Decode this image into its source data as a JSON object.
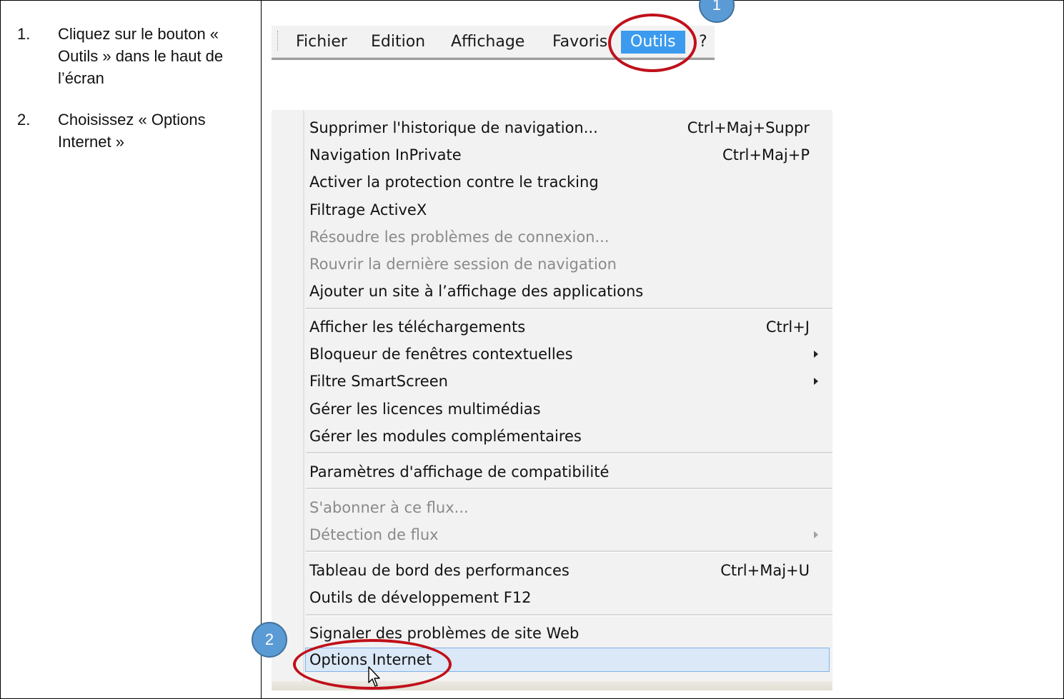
{
  "instructions": [
    {
      "number": "1.",
      "text": "Cliquez sur le bouton « Outils » dans le haut de l’écran"
    },
    {
      "number": "2.",
      "text": "Choisissez « Options Internet »"
    }
  ],
  "menubar": {
    "items": [
      "Fichier",
      "Edition",
      "Affichage",
      "Favoris",
      "Outils",
      "?"
    ],
    "active": "Outils"
  },
  "dropdown": {
    "items": [
      {
        "label": "Supprimer l'historique de navigation...",
        "shortcut": "Ctrl+Maj+Suppr"
      },
      {
        "label": "Navigation InPrivate",
        "shortcut": "Ctrl+Maj+P"
      },
      {
        "label": "Activer la protection contre le tracking"
      },
      {
        "label": "Filtrage ActiveX"
      },
      {
        "label": "Résoudre les problèmes de connexion...",
        "state": "disabled"
      },
      {
        "label": "Rouvrir la dernière session de navigation",
        "state": "disabled"
      },
      {
        "label": "Ajouter un site à l’affichage des applications"
      },
      {
        "label": "Afficher les téléchargements",
        "shortcut": "Ctrl+J"
      },
      {
        "label": "Bloqueur de fenêtres contextuelles",
        "submenu": true
      },
      {
        "label": "Filtre SmartScreen",
        "submenu": true
      },
      {
        "label": "Gérer les licences multimédias"
      },
      {
        "label": "Gérer les modules complémentaires"
      },
      {
        "label": "Paramètres d'affichage de compatibilité"
      },
      {
        "label": "S'abonner à ce flux...",
        "state": "disabled"
      },
      {
        "label": "Détection de flux",
        "state": "disabled",
        "submenu": true
      },
      {
        "label": "Tableau de bord des performances",
        "shortcut": "Ctrl+Maj+U"
      },
      {
        "label": "Outils de développement F12"
      },
      {
        "label": "Signaler des problèmes de site Web"
      },
      {
        "label": "Options Internet",
        "state": "highlighted"
      }
    ]
  },
  "callouts": [
    {
      "number": "1",
      "target": "Outils"
    },
    {
      "number": "2",
      "target": "Options Internet"
    }
  ],
  "colors": {
    "menu_active": "#3c9bee",
    "highlight_fill": "#dbe8f7",
    "highlight_border": "#7eb4ea",
    "callout_fill": "#5b9bd5",
    "ring": "#c0101a"
  }
}
